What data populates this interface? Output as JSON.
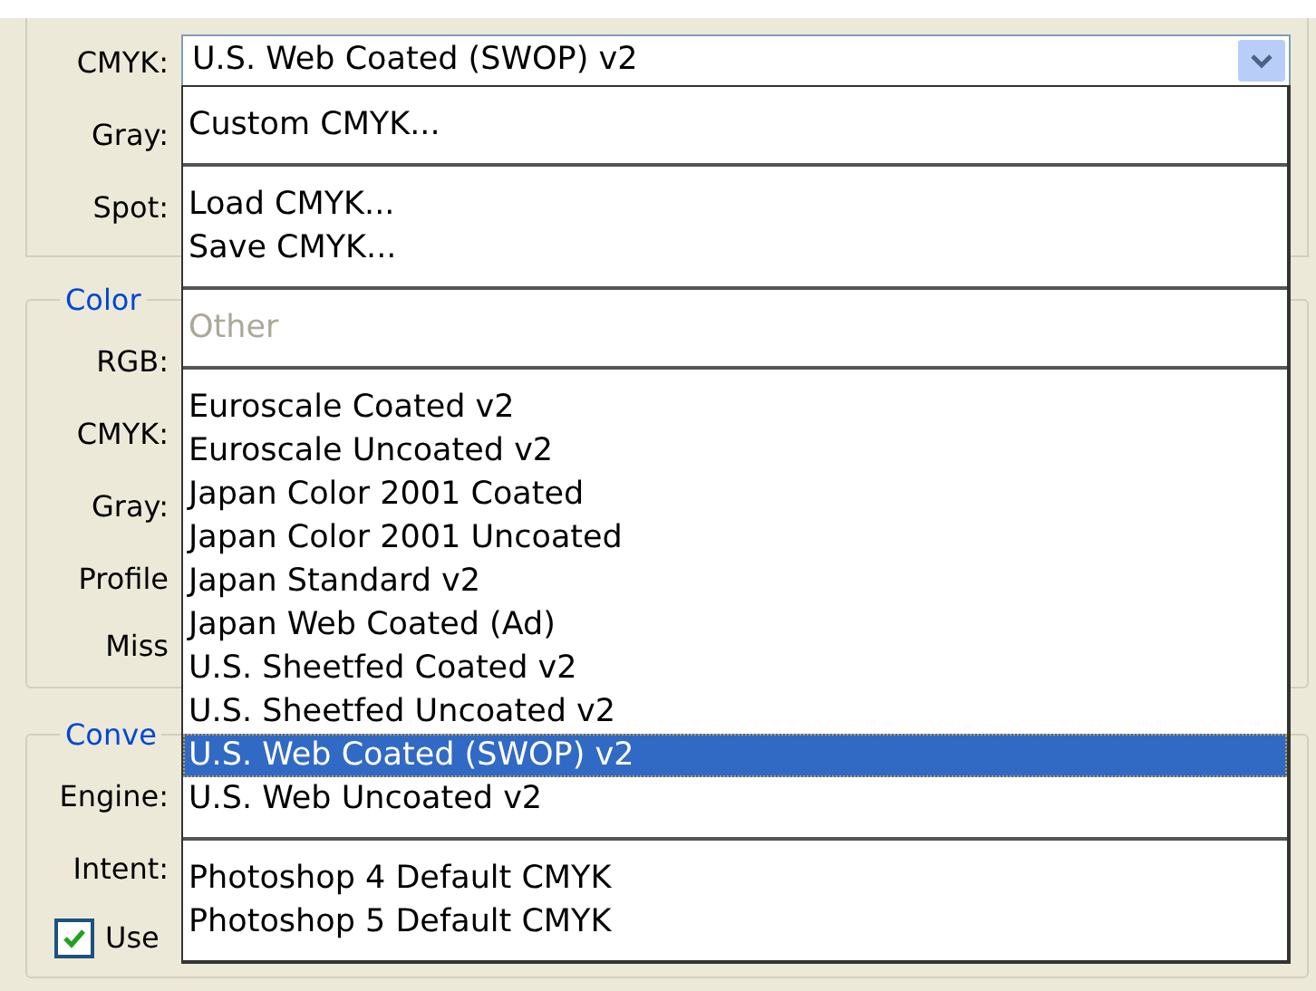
{
  "color_settings": {
    "working_spaces": {
      "rows": [
        {
          "label": "CMYK:"
        },
        {
          "label": "Gray:"
        },
        {
          "label": "Spot:"
        }
      ]
    },
    "policies": {
      "title": "Color",
      "rows": [
        {
          "label": "RGB:"
        },
        {
          "label": "CMYK:"
        },
        {
          "label": "Gray:"
        },
        {
          "label": "Profile"
        },
        {
          "label": "Miss"
        }
      ]
    },
    "conversion": {
      "title": "Conve",
      "rows": [
        {
          "label": "Engine:"
        },
        {
          "label": "Intent:"
        }
      ],
      "checkbox": {
        "label": "Use",
        "checked": true
      }
    }
  },
  "cmyk_dropdown": {
    "value": "U.S. Web Coated (SWOP) v2",
    "expanded": true,
    "sections": [
      {
        "items": [
          {
            "label": "Custom CMYK...",
            "disabled": false,
            "selected": false
          }
        ]
      },
      {
        "items": [
          {
            "label": "Load CMYK...",
            "disabled": false,
            "selected": false
          },
          {
            "label": "Save CMYK...",
            "disabled": false,
            "selected": false
          }
        ]
      },
      {
        "items": [
          {
            "label": "Other",
            "disabled": true,
            "selected": false
          }
        ]
      },
      {
        "items": [
          {
            "label": "Euroscale Coated v2",
            "disabled": false,
            "selected": false
          },
          {
            "label": "Euroscale Uncoated v2",
            "disabled": false,
            "selected": false
          },
          {
            "label": "Japan Color 2001 Coated",
            "disabled": false,
            "selected": false
          },
          {
            "label": "Japan Color 2001 Uncoated",
            "disabled": false,
            "selected": false
          },
          {
            "label": "Japan Standard v2",
            "disabled": false,
            "selected": false
          },
          {
            "label": "Japan Web Coated (Ad)",
            "disabled": false,
            "selected": false
          },
          {
            "label": "U.S. Sheetfed Coated v2",
            "disabled": false,
            "selected": false
          },
          {
            "label": "U.S. Sheetfed Uncoated v2",
            "disabled": false,
            "selected": false
          },
          {
            "label": "U.S. Web Coated (SWOP) v2",
            "disabled": false,
            "selected": true
          },
          {
            "label": "U.S. Web Uncoated v2",
            "disabled": false,
            "selected": false
          }
        ]
      },
      {
        "items": [
          {
            "label": "Photoshop 4 Default CMYK",
            "disabled": false,
            "selected": false
          },
          {
            "label": "Photoshop 5 Default CMYK",
            "disabled": false,
            "selected": false
          }
        ]
      }
    ]
  }
}
